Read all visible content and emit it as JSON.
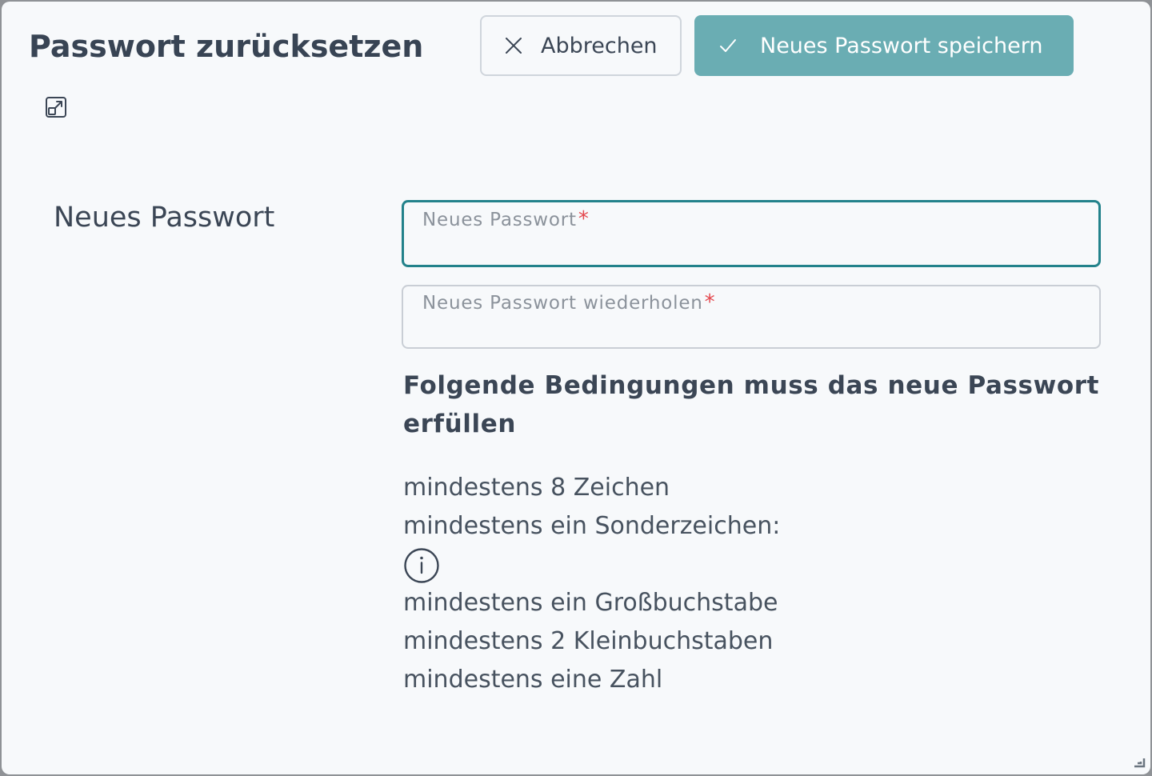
{
  "dialog": {
    "title": "Passwort zurücksetzen",
    "cancel_label": "Abbrechen",
    "save_label": "Neues Passwort speichern"
  },
  "form": {
    "section_label": "Neues Passwort",
    "new_password": {
      "placeholder": "Neues Passwort",
      "required_marker": "*",
      "value": ""
    },
    "repeat_password": {
      "placeholder": "Neues Passwort wiederholen",
      "required_marker": "*",
      "value": ""
    }
  },
  "conditions": {
    "heading": "Folgende Bedingungen muss das neue Passwort erfüllen",
    "rules": [
      "mindestens 8 Zeichen",
      "mindestens ein Sonderzeichen:",
      "mindestens ein Großbuchstabe",
      "mindestens 2 Kleinbuchstaben",
      "mindestens eine Zahl"
    ]
  },
  "icons": {
    "cancel": "close-icon",
    "save": "checkmark-icon",
    "expand": "expand-icon",
    "info": "info-icon",
    "resize": "resize-handle-icon"
  },
  "colors": {
    "title_text": "#384454",
    "save_button": "#6aadb3",
    "focus_border": "#23828b",
    "required_marker": "#e4484e",
    "background": "#f7f9fb"
  }
}
